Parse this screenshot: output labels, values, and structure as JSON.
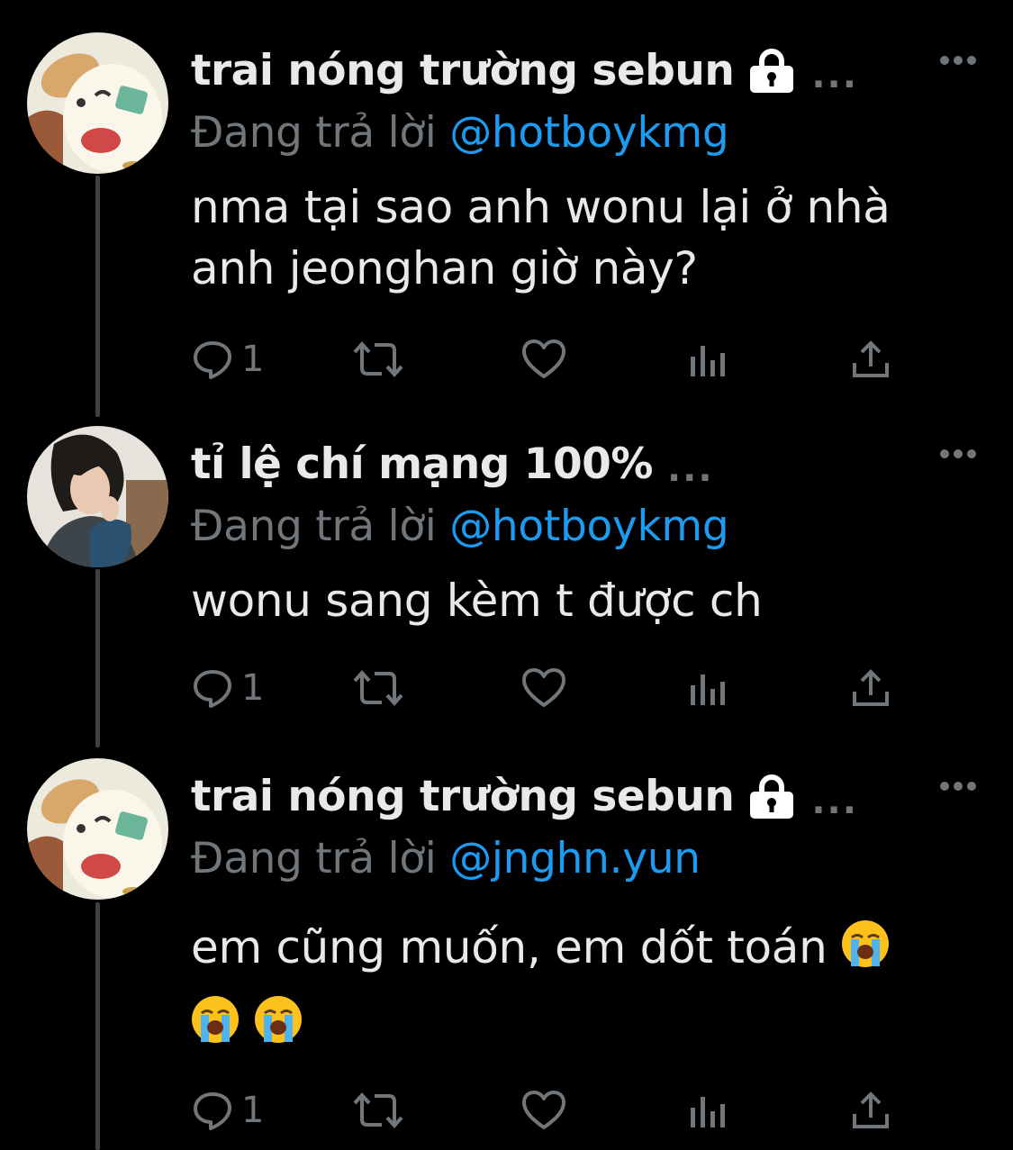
{
  "tweets": [
    {
      "name": "trai nóng trường sebun",
      "locked": true,
      "truncation": "...",
      "reply_label": "Đang trả lời",
      "reply_handle": "@hotboykmg",
      "body_lines": [
        "nma tại sao anh wonu lại ở nhà",
        "anh jeonghan giờ này?"
      ],
      "reply_count": "1",
      "avatar": "cartoon-dog-avatar"
    },
    {
      "name": "tỉ lệ chí mạng 100%",
      "locked": false,
      "truncation": "...",
      "reply_label": "Đang trả lời",
      "reply_handle": "@hotboykmg",
      "body_lines": [
        "wonu sang kèm t được ch"
      ],
      "reply_count": "1",
      "avatar": "person-photo-avatar"
    },
    {
      "name": "trai nóng trường sebun",
      "locked": true,
      "truncation": "...",
      "reply_label": "Đang trả lời",
      "reply_handle": "@jnghn.yun",
      "body_lines": [
        "em cũng muốn, em dốt toán"
      ],
      "emojis": [
        "loudly-crying-face",
        "loudly-crying-face",
        "loudly-crying-face"
      ],
      "reply_count": "1",
      "avatar": "cartoon-dog-avatar"
    }
  ],
  "colors": {
    "background": "#000000",
    "text": "#e7e9ea",
    "secondary": "#71767b",
    "accent": "#1d9bf0",
    "thread_line": "#3e4144"
  }
}
